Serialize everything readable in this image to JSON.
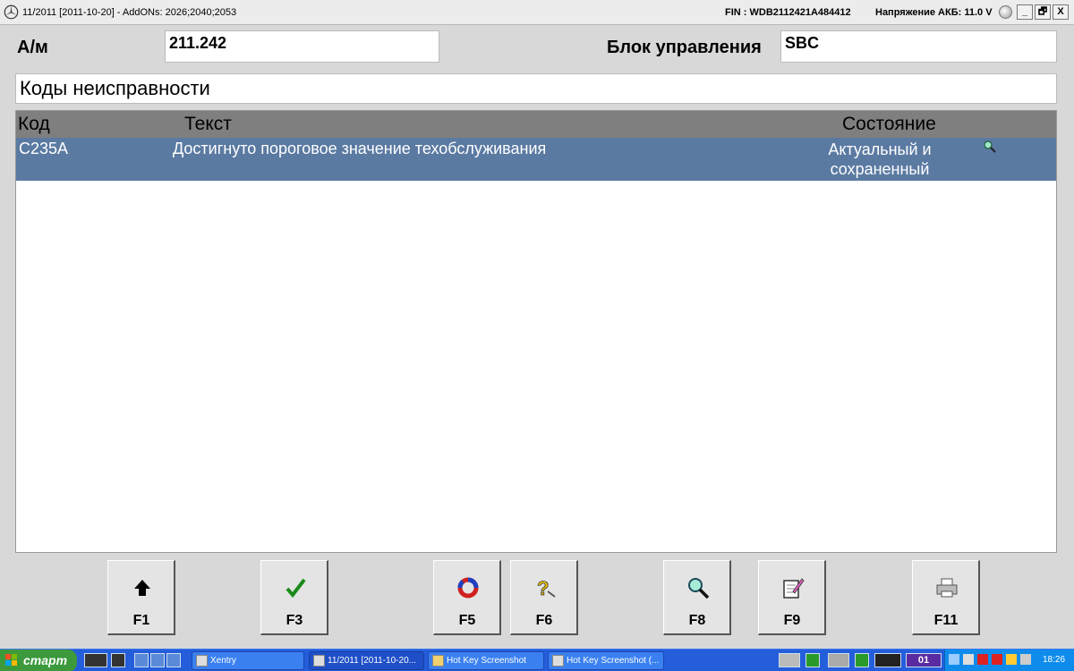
{
  "titlebar": {
    "title": "11/2011 [2011-10-20] - AddONs: 2026;2040;2053",
    "fin": "FIN : WDB2112421A484412",
    "voltage": "Напряжение АКБ: 11.0 V",
    "minimize": "_",
    "restore": "🗗",
    "close": "X"
  },
  "header": {
    "car_label": "А/м",
    "car_value": "211.242",
    "unit_label": "Блок управления",
    "unit_value": "SBC"
  },
  "section_title": "Коды неисправности",
  "table": {
    "columns": [
      "Код",
      "Текст",
      "Состояние"
    ],
    "rows": [
      {
        "code": "C235A",
        "text": "Достигнуто пороговое значение техобслуживания",
        "status_line1": "Актуальный и",
        "status_line2": "сохраненный"
      }
    ]
  },
  "fkeys": [
    "F1",
    "F3",
    "F5",
    "F6",
    "F8",
    "F9",
    "F11"
  ],
  "taskbar": {
    "start": "старт",
    "buttons": [
      "Xentry",
      "11/2011 [2011-10-20...",
      "Hot Key Screenshot",
      "Hot Key Screenshot (..."
    ],
    "tray_badge": "01",
    "clock": "18:26"
  },
  "colors": {
    "row_selected": "#5b7aa2",
    "table_header": "#7f7f7f",
    "taskbar": "#245edb",
    "start": "#3c9a3c"
  }
}
